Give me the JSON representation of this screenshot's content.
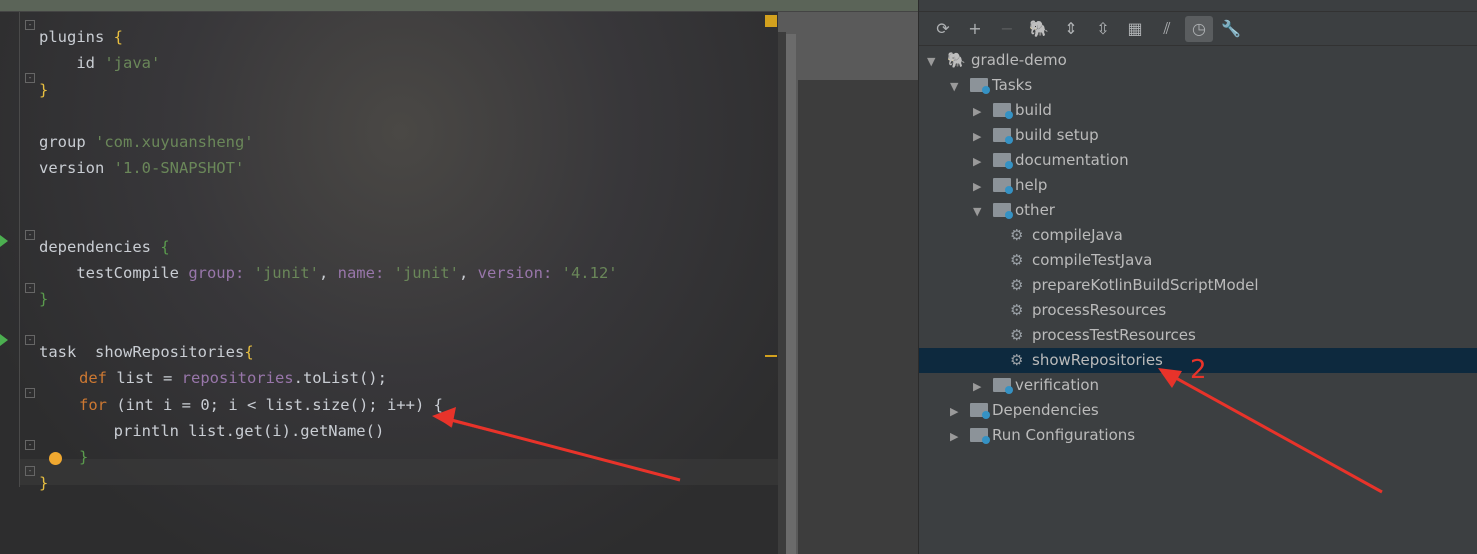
{
  "editor": {
    "lines": [
      {
        "t": "plugins",
        "b": " {"
      },
      {
        "a": "    id ",
        "s": "'java'"
      },
      {
        "b": "}"
      },
      {
        "a": "group ",
        "s": "'com.xuyuansheng'"
      },
      {
        "a": "version ",
        "s": "'1.0-SNAPSHOT'"
      },
      {
        "a": "dependencies ",
        "b": "{"
      },
      {
        "a": "    testCompile ",
        "k1": "group: ",
        "s1": "'junit'",
        "c1": ", ",
        "k2": "name: ",
        "s2": "'junit'",
        "c2": ", ",
        "k3": "version: ",
        "s3": "'4.12'"
      },
      {
        "b": "}"
      },
      {
        "a": "task  showRepositories",
        "b": "{"
      },
      {
        "k": "def",
        "a": " list = ",
        "p": "repositories",
        "r": ".toList();"
      },
      {
        "k": "for",
        "r": " (int i = 0; i < list.size(); i++) {"
      },
      {
        "a": "        println list.get(i).getName()"
      },
      {
        "b": "}"
      },
      {
        "b": "}"
      }
    ]
  },
  "gradle_panel": {
    "toolbar": [
      "refresh-icon",
      "add-icon",
      "remove-icon",
      "gradle-elephant-icon",
      "expand-all-icon",
      "collapse-all-icon",
      "group-modules-icon",
      "toggle-offline-icon",
      "show-history-icon",
      "settings-wrench-icon"
    ],
    "tree": [
      {
        "label": "gradle-demo",
        "level": 0,
        "expanded": true,
        "icon": "gradle"
      },
      {
        "label": "Tasks",
        "level": 1,
        "expanded": true,
        "icon": "folder"
      },
      {
        "label": "build",
        "level": 2,
        "expanded": false,
        "icon": "folder"
      },
      {
        "label": "build setup",
        "level": 2,
        "expanded": false,
        "icon": "folder"
      },
      {
        "label": "documentation",
        "level": 2,
        "expanded": false,
        "icon": "folder"
      },
      {
        "label": "help",
        "level": 2,
        "expanded": false,
        "icon": "folder"
      },
      {
        "label": "other",
        "level": 2,
        "expanded": true,
        "icon": "folder"
      },
      {
        "label": "compileJava",
        "level": 3,
        "icon": "gear"
      },
      {
        "label": "compileTestJava",
        "level": 3,
        "icon": "gear"
      },
      {
        "label": "prepareKotlinBuildScriptModel",
        "level": 3,
        "icon": "gear"
      },
      {
        "label": "processResources",
        "level": 3,
        "icon": "gear"
      },
      {
        "label": "processTestResources",
        "level": 3,
        "icon": "gear"
      },
      {
        "label": "showRepositories",
        "level": 3,
        "icon": "gear",
        "selected": true
      },
      {
        "label": "verification",
        "level": 2,
        "expanded": false,
        "icon": "folder"
      },
      {
        "label": "Dependencies",
        "level": 1,
        "expanded": false,
        "icon": "folder"
      },
      {
        "label": "Run Configurations",
        "level": 1,
        "expanded": false,
        "icon": "folder"
      }
    ]
  },
  "annotation": {
    "label": "2",
    "color": "#e8332a"
  },
  "colors": {
    "selection": "#0d293e",
    "keyword": "#cc7832",
    "string": "#6a8759"
  }
}
